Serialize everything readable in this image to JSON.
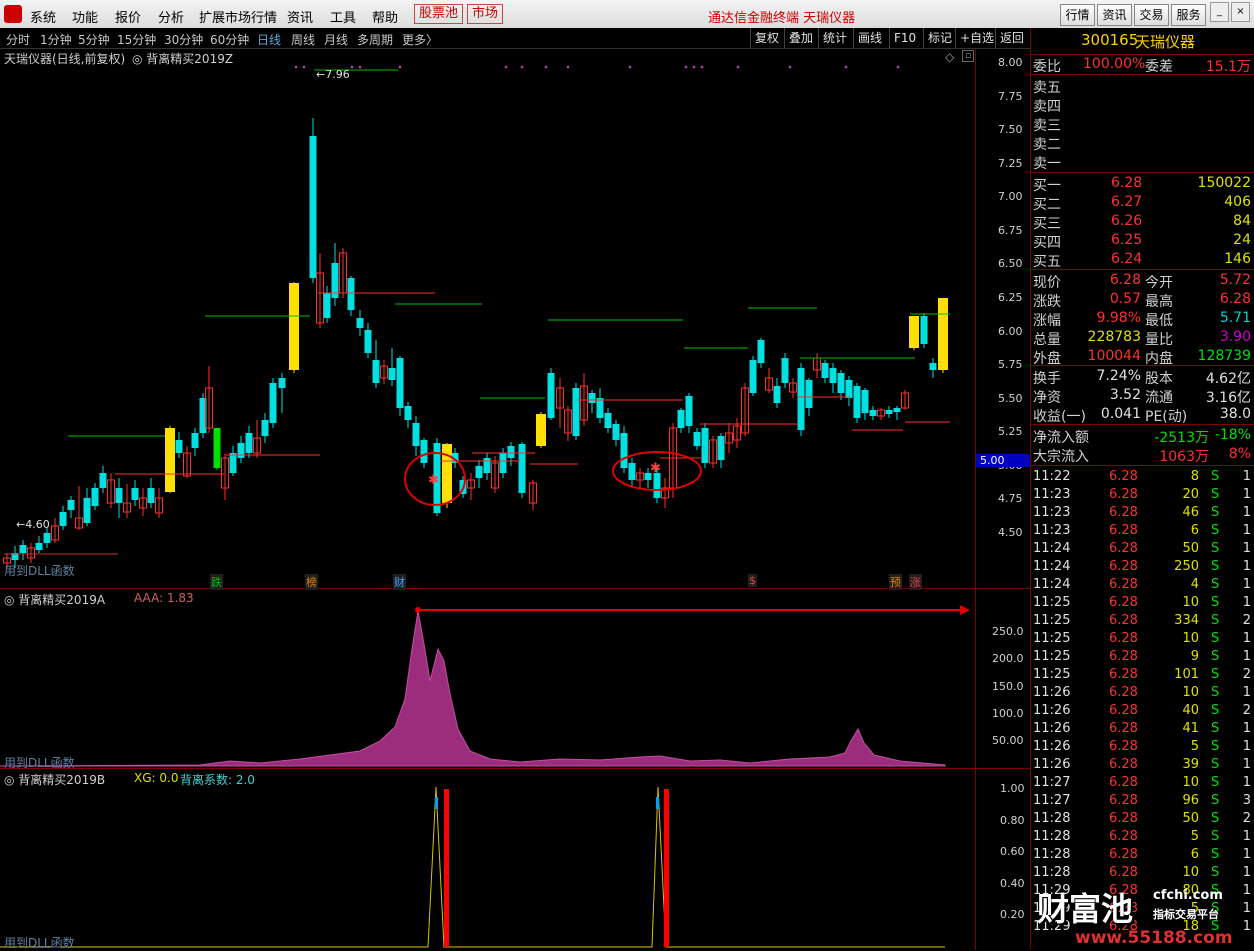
{
  "menu": {
    "items": [
      "系统",
      "功能",
      "报价",
      "分析",
      "扩展市场行情",
      "资讯",
      "工具",
      "帮助"
    ],
    "highlight": [
      "股票池",
      "市场"
    ],
    "title": "通达信金融终端  天瑞仪器",
    "right_buttons": [
      "行情",
      "资讯",
      "交易",
      "服务"
    ]
  },
  "periods": [
    "分时",
    "1分钟",
    "5分钟",
    "15分钟",
    "30分钟",
    "60分钟",
    "日线",
    "周线",
    "月线",
    "多周期",
    "更多〉"
  ],
  "active_period": "日线",
  "tools": [
    "复权",
    "叠加",
    "统计",
    "画线",
    "F10",
    "标记",
    "+自选",
    "返回"
  ],
  "main_panel": {
    "title": "天瑞仪器(日线,前复权)",
    "indicator": "背离精买2019Z",
    "y_ticks": [
      "8.00",
      "7.75",
      "7.50",
      "7.25",
      "7.00",
      "6.75",
      "6.50",
      "6.25",
      "6.00",
      "5.75",
      "5.50",
      "5.25",
      "5.00",
      "4.75",
      "4.50"
    ],
    "high_label": "7.96",
    "low_label": "4.60",
    "price_tag": "5.00",
    "dll_note": "用到DLL函数",
    "events": [
      {
        "text": "跌",
        "color": "#00c000"
      },
      {
        "text": "榜",
        "color": "#e08000"
      },
      {
        "text": "财",
        "color": "#40a0ff"
      },
      {
        "text": "$",
        "color": "#e04040"
      },
      {
        "text": "预",
        "color": "#e08000"
      },
      {
        "text": "涨",
        "color": "#e04040"
      }
    ]
  },
  "panel_a": {
    "title": "背离精买2019A",
    "label": "AAA: 1.83",
    "y_ticks": [
      "250.0",
      "200.0",
      "150.0",
      "100.0",
      "50.00"
    ],
    "dll_note": "用到DLL函数"
  },
  "panel_b": {
    "title": "背离精买2019B",
    "label_xg": "XG: 0.0",
    "label_coef": "背离系数: 2.0",
    "y_ticks": [
      "1.00",
      "0.80",
      "0.60",
      "0.40",
      "0.20"
    ],
    "dll_note": "用到DLL函数"
  },
  "quote": {
    "code": "300165",
    "name": "天瑞仪器",
    "weibi_label": "委比",
    "weibi": "100.00%",
    "weicha_label": "委差",
    "weicha": "15.1万",
    "sell": [
      "卖五",
      "卖四",
      "卖三",
      "卖二",
      "卖一"
    ],
    "buy": [
      {
        "label": "买一",
        "price": "6.28",
        "vol": "150022"
      },
      {
        "label": "买二",
        "price": "6.27",
        "vol": "406"
      },
      {
        "label": "买三",
        "price": "6.26",
        "vol": "84"
      },
      {
        "label": "买四",
        "price": "6.25",
        "vol": "24"
      },
      {
        "label": "买五",
        "price": "6.24",
        "vol": "146"
      }
    ],
    "stats": [
      {
        "l1": "现价",
        "v1": "6.28",
        "c1": "#ff3030",
        "l2": "今开",
        "v2": "5.72",
        "c2": "#ff3030"
      },
      {
        "l1": "涨跌",
        "v1": "0.57",
        "c1": "#ff3030",
        "l2": "最高",
        "v2": "6.28",
        "c2": "#ff3030"
      },
      {
        "l1": "涨幅",
        "v1": "9.98%",
        "c1": "#ff3030",
        "l2": "最低",
        "v2": "5.71",
        "c2": "#00d0d0"
      },
      {
        "l1": "总量",
        "v1": "228783",
        "c1": "#e0e000",
        "l2": "量比",
        "v2": "3.90",
        "c2": "#d000d0"
      },
      {
        "l1": "外盘",
        "v1": "100044",
        "c1": "#ff3030",
        "l2": "内盘",
        "v2": "128739",
        "c2": "#00e000"
      }
    ],
    "fund": [
      {
        "l1": "换手",
        "v1": "7.24%",
        "l2": "股本",
        "v2": "4.62亿"
      },
      {
        "l1": "净资",
        "v1": "3.52",
        "l2": "流通",
        "v2": "3.16亿"
      },
      {
        "l1": "收益(一)",
        "v1": "0.041",
        "l2": "PE(动)",
        "v2": "38.0"
      }
    ],
    "flow": [
      {
        "label": "净流入额",
        "val": "-2513万",
        "pct": "-18%",
        "c": "#00e000"
      },
      {
        "label": "大宗流入",
        "val": "1063万",
        "pct": "8%",
        "c": "#ff3030"
      }
    ],
    "ticks": [
      [
        "11:22",
        "6.28",
        "8",
        "S",
        "1"
      ],
      [
        "11:23",
        "6.28",
        "20",
        "S",
        "1"
      ],
      [
        "11:23",
        "6.28",
        "46",
        "S",
        "1"
      ],
      [
        "11:23",
        "6.28",
        "6",
        "S",
        "1"
      ],
      [
        "11:24",
        "6.28",
        "50",
        "S",
        "1"
      ],
      [
        "11:24",
        "6.28",
        "250",
        "S",
        "1"
      ],
      [
        "11:24",
        "6.28",
        "4",
        "S",
        "1"
      ],
      [
        "11:25",
        "6.28",
        "10",
        "S",
        "1"
      ],
      [
        "11:25",
        "6.28",
        "334",
        "S",
        "2"
      ],
      [
        "11:25",
        "6.28",
        "10",
        "S",
        "1"
      ],
      [
        "11:25",
        "6.28",
        "9",
        "S",
        "1"
      ],
      [
        "11:25",
        "6.28",
        "101",
        "S",
        "2"
      ],
      [
        "11:26",
        "6.28",
        "10",
        "S",
        "1"
      ],
      [
        "11:26",
        "6.28",
        "40",
        "S",
        "2"
      ],
      [
        "11:26",
        "6.28",
        "41",
        "S",
        "1"
      ],
      [
        "11:26",
        "6.28",
        "5",
        "S",
        "1"
      ],
      [
        "11:26",
        "6.28",
        "39",
        "S",
        "1"
      ],
      [
        "11:27",
        "6.28",
        "10",
        "S",
        "1"
      ],
      [
        "11:27",
        "6.28",
        "96",
        "S",
        "3"
      ],
      [
        "11:28",
        "6.28",
        "50",
        "S",
        "2"
      ],
      [
        "11:28",
        "6.28",
        "5",
        "S",
        "1"
      ],
      [
        "11:28",
        "6.28",
        "6",
        "S",
        "1"
      ],
      [
        "11:28",
        "6.28",
        "10",
        "S",
        "1"
      ],
      [
        "11:29",
        "6.28",
        "80",
        "S",
        "1"
      ],
      [
        "11:29",
        "6.28",
        "5",
        "S",
        "1"
      ],
      [
        "11:29",
        "6.28",
        "18",
        "S",
        "1"
      ]
    ]
  },
  "watermark": {
    "brand": "财富池",
    "site": "cfchi.com",
    "slogan": "指标交易平台",
    "url": "www.55188.com"
  }
}
